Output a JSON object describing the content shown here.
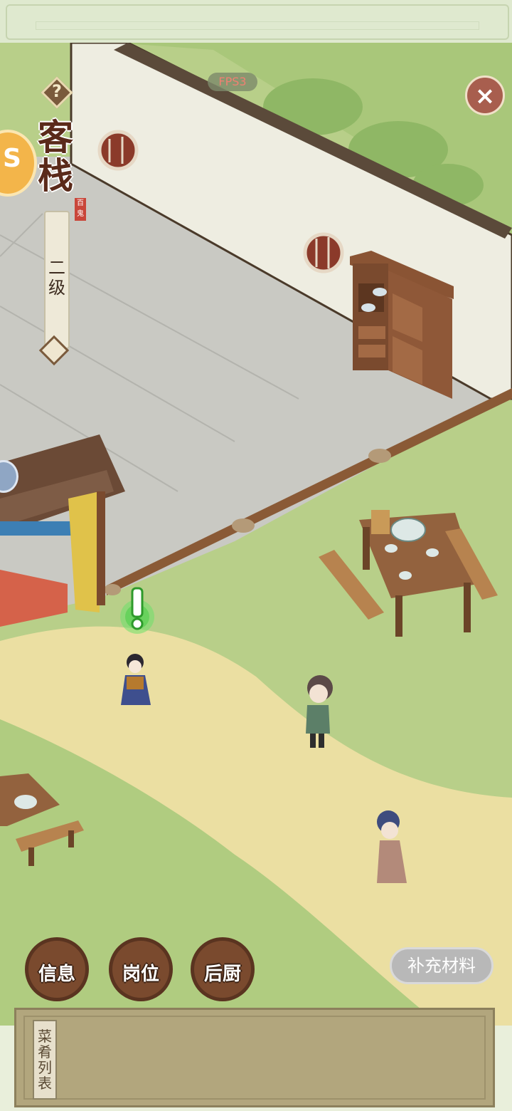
{
  "hud": {
    "fps": "FPS3",
    "help_icon": "?",
    "title": "客栈",
    "seal_text": "百鬼",
    "level": "二级",
    "close_icon": "×"
  },
  "actions": {
    "info": "信息",
    "position": "岗位",
    "kitchen": "后厨",
    "supply": "补充材料"
  },
  "bottom_panel": {
    "dish_list": "菜肴列表"
  },
  "colors": {
    "grass": "#b6cf86",
    "path": "#eadfa0",
    "floor": "#c8c8c3",
    "wall": "#efeee3",
    "wood": "#7a4a2e"
  }
}
